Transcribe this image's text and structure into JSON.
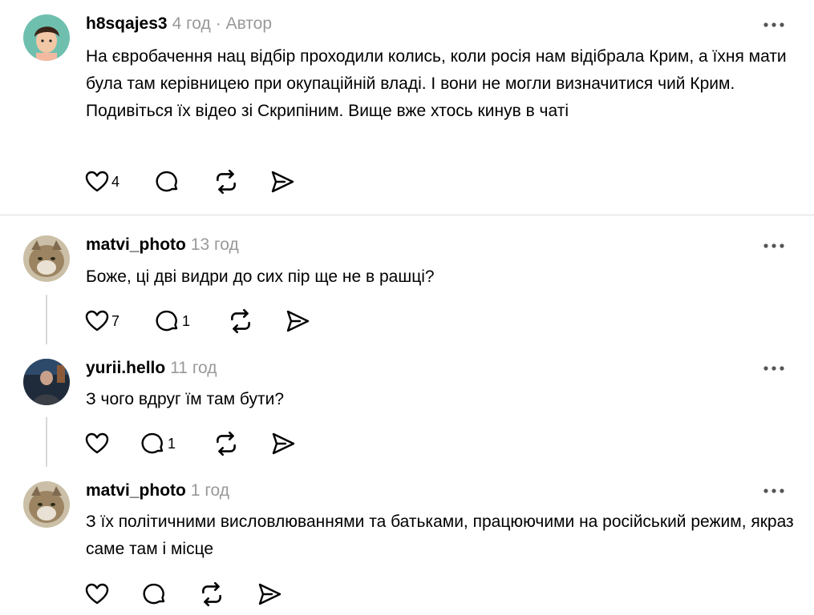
{
  "comments": [
    {
      "username": "h8sqajes3",
      "time": "4 год",
      "author_label": "· Автор",
      "text": "На євробачення нац відбір проходили колись, коли росія нам відібрала Крим, а їхня мати була там керівницею при окупаційній владі. І вони не могли визначитися чий Крим. Подивіться їх відео зі Скрипіним. Вище вже хтось кинув в чаті",
      "like_count": "4",
      "reply_count": ""
    },
    {
      "username": "matvi_photo",
      "time": "13 год",
      "text": "Боже, ці дві видри до сих пір ще не в рашці?",
      "like_count": "7",
      "reply_count": "1"
    },
    {
      "username": "yurii.hello",
      "time": "11 год",
      "text": "З чого вдруг їм там бути?",
      "like_count": "",
      "reply_count": "1"
    },
    {
      "username": "matvi_photo",
      "time": "1 год",
      "text": "З їх політичними висловлюваннями та батьками, працюючими на російський режим, якраз саме там і місце",
      "like_count": "",
      "reply_count": ""
    }
  ],
  "icons": {
    "like": "heart-icon",
    "reply": "speech-bubble-icon",
    "repost": "repost-icon",
    "share": "send-icon",
    "more": "more-dots-icon"
  }
}
